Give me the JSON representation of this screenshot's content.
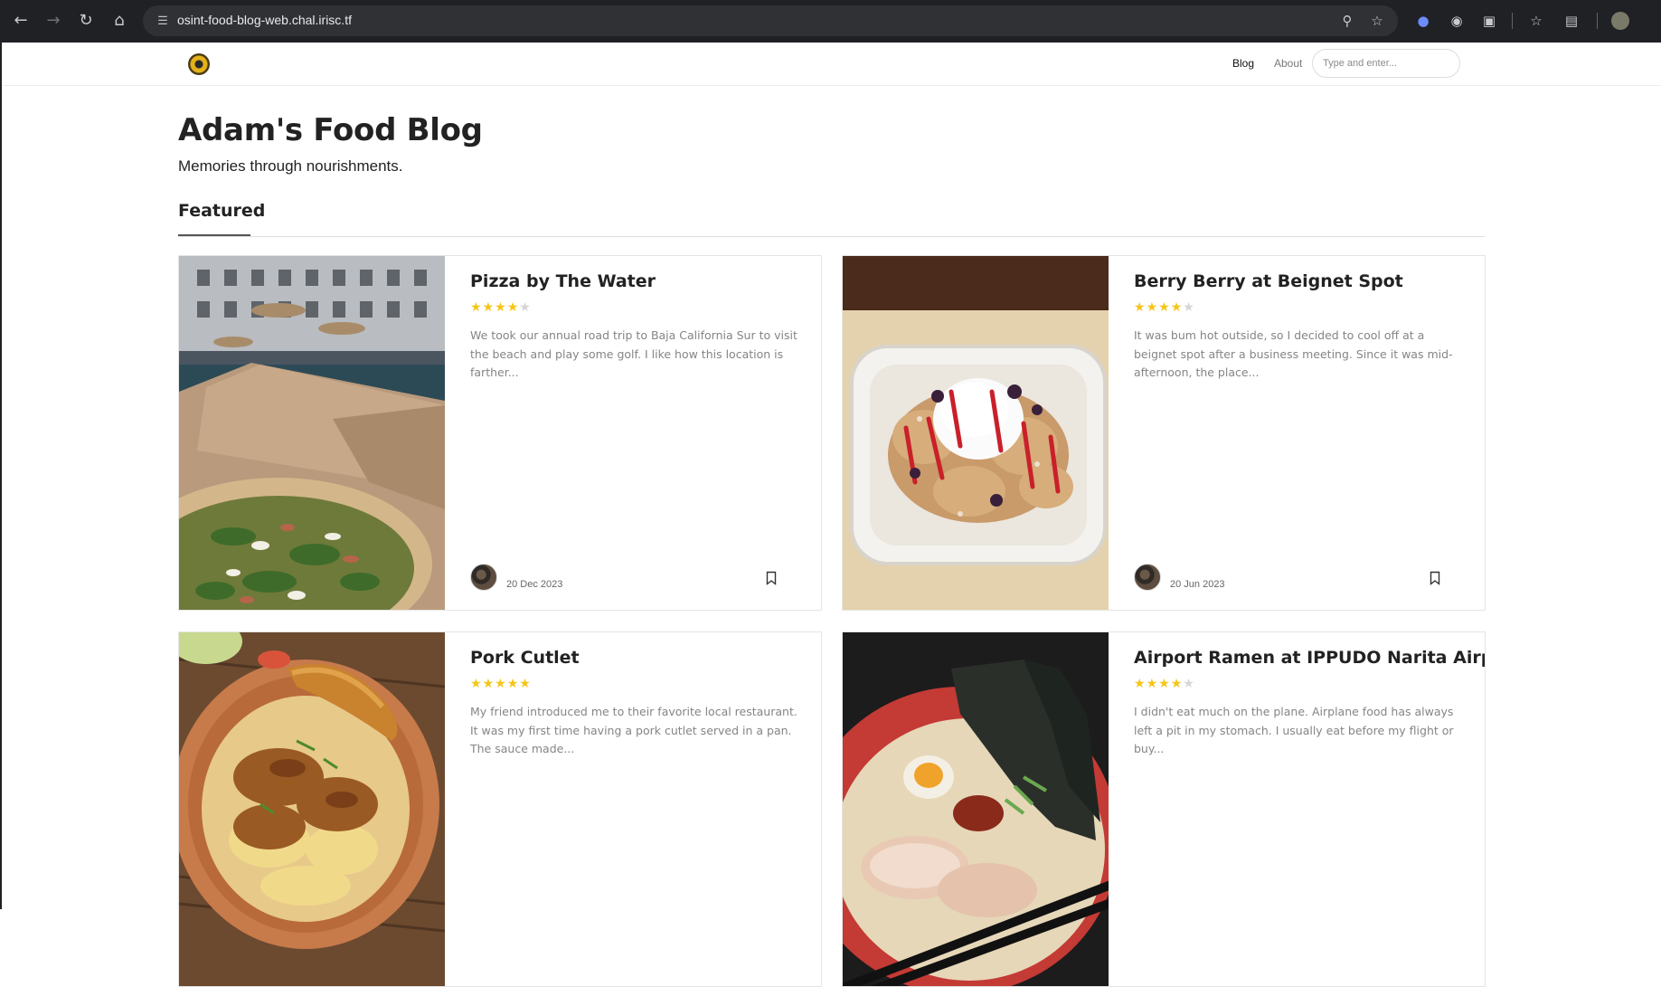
{
  "browser": {
    "url": "osint-food-blog-web.chal.irisc.tf"
  },
  "site": {
    "nav": {
      "blog": "Blog",
      "about": "About"
    },
    "search_placeholder": "Type and enter..."
  },
  "main": {
    "title": "Adam's Food Blog",
    "subtitle": "Memories through nourishments.",
    "featured_heading": "Featured"
  },
  "posts": [
    {
      "title": "Pizza by The Water",
      "rating": 4,
      "excerpt": "We took our annual road trip to Baja California Sur to visit the beach and play some golf. I like how this location is farther...",
      "date": "20 Dec 2023"
    },
    {
      "title": "Berry Berry at Beignet Spot",
      "rating": 4,
      "excerpt": "It was bum hot outside, so I decided to cool off at a beignet spot after a business meeting. Since it was mid-afternoon, the place...",
      "date": "20 Jun 2023"
    },
    {
      "title": "Pork Cutlet",
      "rating": 5,
      "excerpt": "My friend introduced me to their favorite local restaurant. It was my first time having a pork cutlet served in a pan. The sauce made...",
      "date": ""
    },
    {
      "title": "Airport Ramen at IPPUDO Narita Airport",
      "rating": 4,
      "excerpt": "I didn't eat much on the plane. Airplane food has always left a pit in my stomach. I usually eat before my flight or buy...",
      "date": ""
    }
  ],
  "colors": {
    "star_on": "#f5c518",
    "star_off": "#d6d6d6",
    "chrome_bg": "#202124"
  }
}
